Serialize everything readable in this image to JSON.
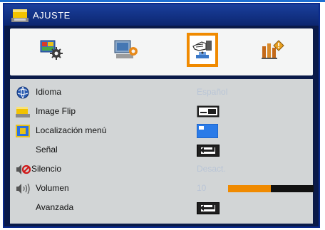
{
  "title": "AJUSTE",
  "tabs": [
    {
      "name": "image",
      "icon": "display-settings-icon",
      "active": false
    },
    {
      "name": "display",
      "icon": "screen-settings-icon",
      "active": false
    },
    {
      "name": "setup",
      "icon": "setup-hand-icon",
      "active": true
    },
    {
      "name": "options",
      "icon": "options-info-icon",
      "active": false
    }
  ],
  "rows": [
    {
      "label": "Idioma",
      "value": "Español",
      "icon": "globe-icon"
    },
    {
      "label": "Image Flip",
      "value": "",
      "icon": "projector-icon",
      "control": "flip-icon"
    },
    {
      "label": "Localización menú",
      "value": "",
      "icon": "menu-location-icon",
      "control": "menu-position-icon"
    },
    {
      "label": "Señal",
      "value": "",
      "icon": "",
      "control": "enter-button"
    },
    {
      "label": "Silencio",
      "value": "Desact.",
      "icon": "mute-icon"
    },
    {
      "label": "Volumen",
      "value": "10",
      "icon": "speaker-icon",
      "control": "volume-slider",
      "level_fraction": 0.5
    },
    {
      "label": "Avanzada",
      "value": "",
      "icon": "",
      "control": "enter-button"
    }
  ],
  "colors": {
    "accent": "#f08a00",
    "titlebar": "#1a3f9c",
    "value_text": "#b9c5d6",
    "panel": "#d2d5d6"
  }
}
